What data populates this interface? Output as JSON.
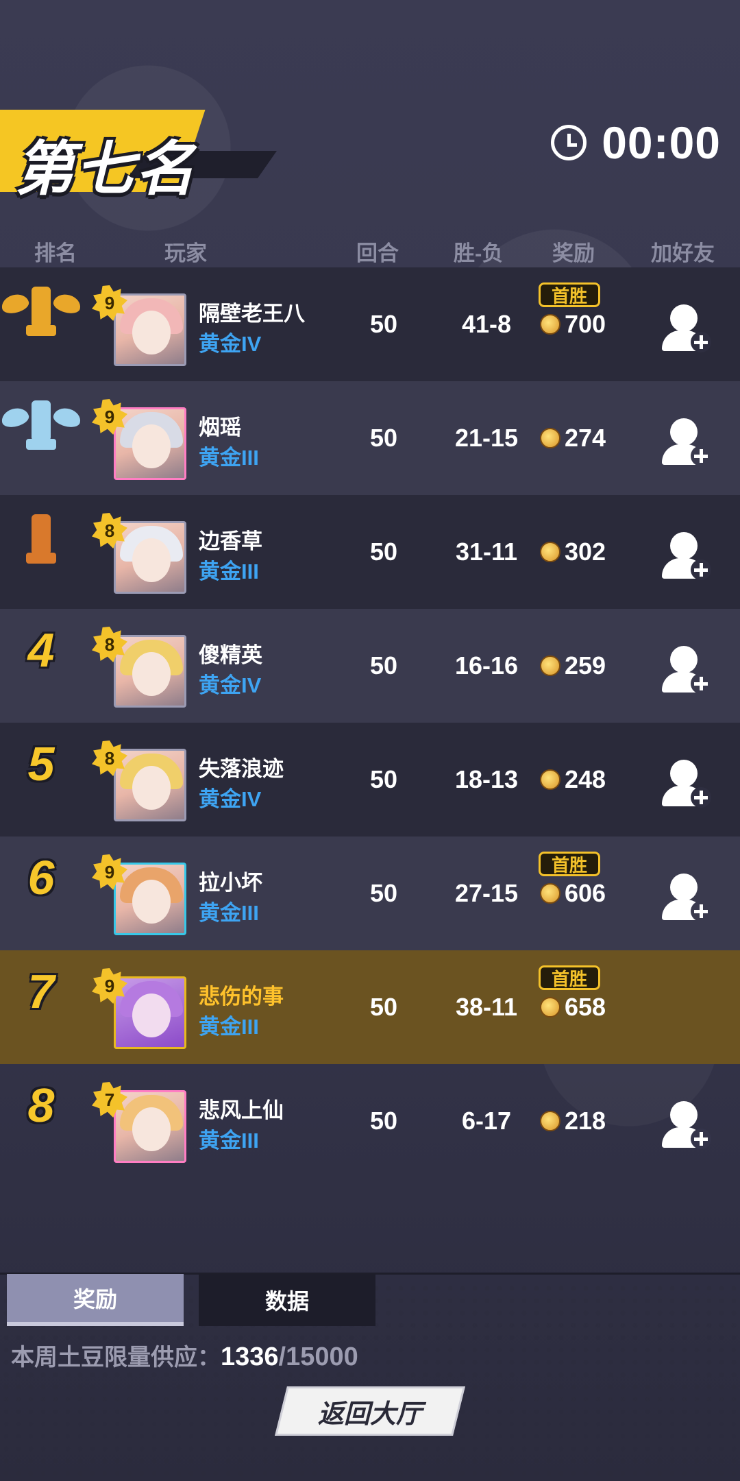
{
  "header": {
    "placement_title": "第七名",
    "timer": "00:00"
  },
  "columns": {
    "rank": "排名",
    "player": "玩家",
    "rounds": "回合",
    "win_loss": "胜-负",
    "reward": "奖励",
    "add_friend": "加好友"
  },
  "rows": [
    {
      "rank": "1",
      "trophy": "gold-trophy",
      "level": "9",
      "name": "隔壁老王八",
      "tier": "黄金IV",
      "rounds": "50",
      "win_loss": "41-8",
      "reward": "700",
      "first_win": "首胜",
      "add_friend": true
    },
    {
      "rank": "2",
      "trophy": "silver-trophy",
      "level": "9",
      "name": "烟瑶",
      "tier": "黄金III",
      "rounds": "50",
      "win_loss": "21-15",
      "reward": "274",
      "first_win": "",
      "add_friend": true
    },
    {
      "rank": "3",
      "trophy": "bronze-trophy",
      "level": "8",
      "name": "边香草",
      "tier": "黄金III",
      "rounds": "50",
      "win_loss": "31-11",
      "reward": "302",
      "first_win": "",
      "add_friend": true
    },
    {
      "rank": "4",
      "level": "8",
      "name": "傻精英",
      "tier": "黄金IV",
      "rounds": "50",
      "win_loss": "16-16",
      "reward": "259",
      "first_win": "",
      "add_friend": true
    },
    {
      "rank": "5",
      "level": "8",
      "name": "失落浪迹",
      "tier": "黄金IV",
      "rounds": "50",
      "win_loss": "18-13",
      "reward": "248",
      "first_win": "",
      "add_friend": true
    },
    {
      "rank": "6",
      "level": "9",
      "name": "拉小坏",
      "tier": "黄金III",
      "rounds": "50",
      "win_loss": "27-15",
      "reward": "606",
      "first_win": "首胜",
      "add_friend": true
    },
    {
      "rank": "7",
      "level": "9",
      "name": "悲伤的事",
      "tier": "黄金III",
      "rounds": "50",
      "win_loss": "38-11",
      "reward": "658",
      "first_win": "首胜",
      "add_friend": false,
      "is_self": true
    },
    {
      "rank": "8",
      "level": "7",
      "name": "悲风上仙",
      "tier": "黄金III",
      "rounds": "50",
      "win_loss": "6-17",
      "reward": "218",
      "first_win": "",
      "add_friend": true
    }
  ],
  "tabs": {
    "reward": "奖励",
    "data": "数据"
  },
  "supply": {
    "label": "本周土豆限量供应：",
    "current": "1336",
    "max": "/15000"
  },
  "back_button": "返回大厅",
  "colors": {
    "gold": "#f4c22a",
    "tier_blue": "#3ea4f2",
    "self_row": "#6b5321"
  }
}
